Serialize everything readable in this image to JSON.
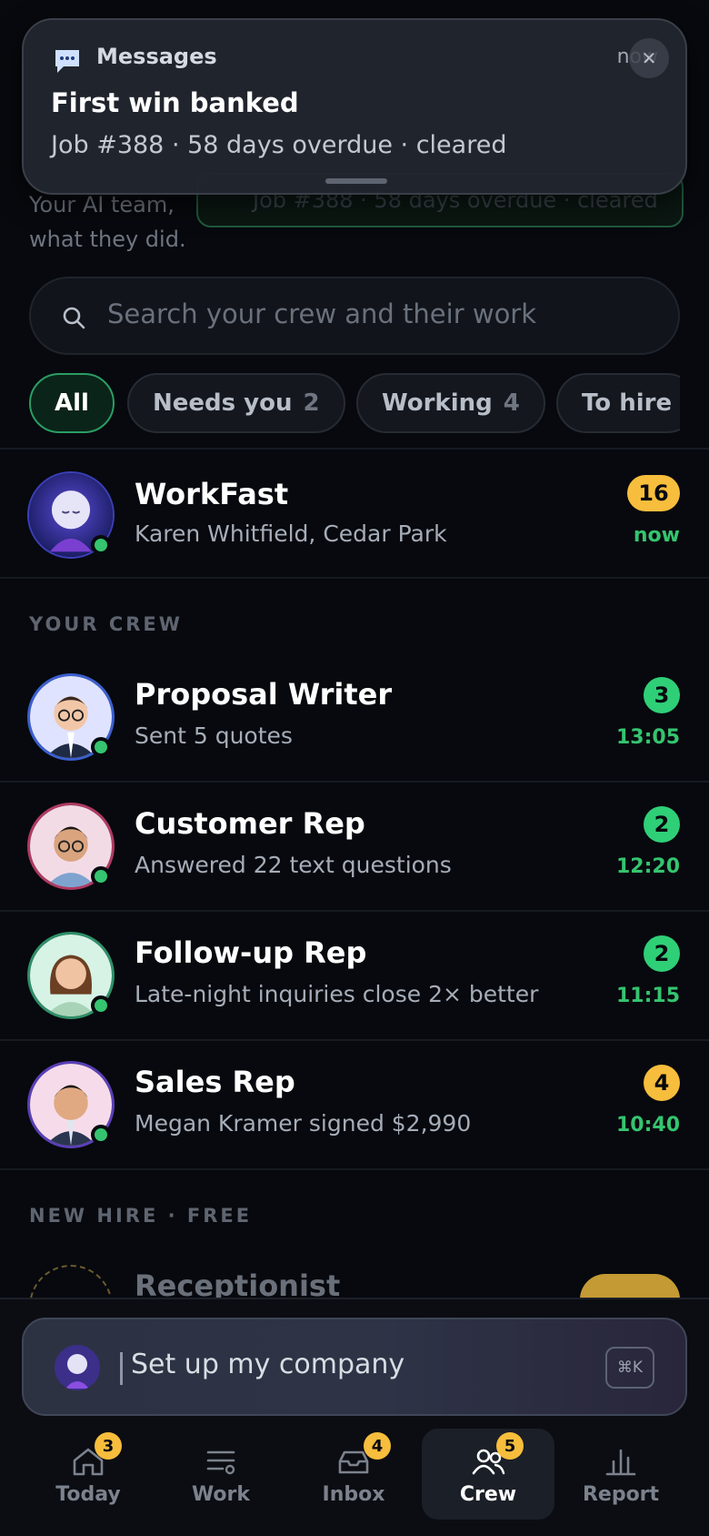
{
  "notification": {
    "app": "Messages",
    "time": "now",
    "title": "First win banked",
    "body": "Job #388 · 58 days overdue · cleared"
  },
  "header": {
    "subtitle": "Your AI team, what they did.",
    "toast_peek": "Job #388 · 58 days overdue · cleared"
  },
  "search": {
    "placeholder": "Search your crew and their work"
  },
  "filters": [
    {
      "label": "All",
      "count": ""
    },
    {
      "label": "Needs you",
      "count": "2"
    },
    {
      "label": "Working",
      "count": "4"
    },
    {
      "label": "To hire",
      "count": ""
    }
  ],
  "pinned": {
    "name": "WorkFast",
    "subtitle": "Karen Whitfield, Cedar Park",
    "badge": "16",
    "time": "now"
  },
  "crew_section": "YOUR CREW",
  "crew": [
    {
      "name": "Proposal Writer",
      "subtitle": "Sent 5 quotes",
      "badge": "3",
      "time": "13:05"
    },
    {
      "name": "Customer Rep",
      "subtitle": "Answered 22 text questions",
      "badge": "2",
      "time": "12:20"
    },
    {
      "name": "Follow-up Rep",
      "subtitle": "Late-night inquiries close 2× better",
      "badge": "2",
      "time": "11:15"
    },
    {
      "name": "Sales Rep",
      "subtitle": "Megan Kramer signed $2,990",
      "badge": "4",
      "time": "10:40"
    }
  ],
  "new_hire_section": "NEW HIRE · FREE",
  "new_hire": {
    "name": "Receptionist"
  },
  "composer": {
    "text": "Set up my company",
    "shortcut": "⌘K"
  },
  "tabs": [
    {
      "label": "Today",
      "badge": "3",
      "icon": "home-icon"
    },
    {
      "label": "Work",
      "badge": "",
      "icon": "list-icon"
    },
    {
      "label": "Inbox",
      "badge": "4",
      "icon": "inbox-icon"
    },
    {
      "label": "Crew",
      "badge": "5",
      "icon": "people-icon"
    },
    {
      "label": "Report",
      "badge": "",
      "icon": "bar-chart-icon"
    }
  ],
  "colors": {
    "accent_green": "#35c46f",
    "badge_amber": "#f7bd3c",
    "background": "#07090e"
  }
}
